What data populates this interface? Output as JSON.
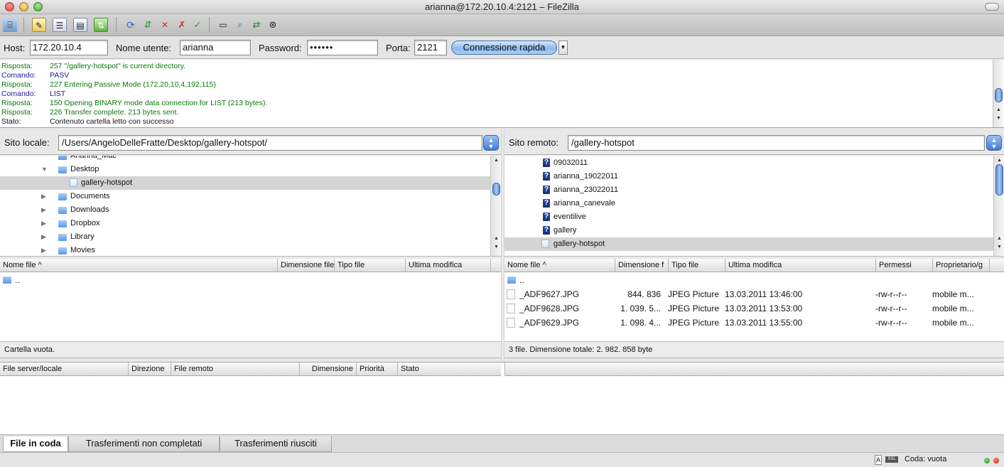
{
  "window": {
    "title": "arianna@172.20.10.4:2121 – FileZilla"
  },
  "toolbar": {
    "icons": [
      "site-manager-icon",
      "message-log-icon",
      "local-tree-icon",
      "remote-tree-icon",
      "transfer-queue-icon",
      "refresh-icon",
      "process-queue-icon",
      "cancel-icon",
      "disconnect-icon",
      "reconnect-icon",
      "filter-icon",
      "compare-icon",
      "sync-browse-icon",
      "search-icon"
    ]
  },
  "connection": {
    "host_label": "Host:",
    "host_value": "172.20.10.4",
    "user_label": "Nome utente:",
    "user_value": "arianna",
    "pass_label": "Password:",
    "pass_value": "••••••",
    "port_label": "Porta:",
    "port_value": "2121",
    "quick_label": "Connessione rapida",
    "accent": "#8cbaf0"
  },
  "log": [
    {
      "type": "Risposta:",
      "msg": "257 \"/gallery-hotspot\" is current directory.",
      "kind": "resp"
    },
    {
      "type": "Comando:",
      "msg": "PASV",
      "kind": "cmd"
    },
    {
      "type": "Risposta:",
      "msg": "227 Entering Passive Mode (172,20,10,4,192,115)",
      "kind": "resp"
    },
    {
      "type": "Comando:",
      "msg": "LIST",
      "kind": "cmd"
    },
    {
      "type": "Risposta:",
      "msg": "150 Opening BINARY mode data connection for LIST (213 bytes).",
      "kind": "resp"
    },
    {
      "type": "Risposta:",
      "msg": "226 Transfer complete. 213 bytes sent.",
      "kind": "resp"
    },
    {
      "type": "Stato:",
      "msg": "Contenuto cartella letto con successo",
      "kind": "stat"
    }
  ],
  "local": {
    "site_label": "Sito locale:",
    "path": "/Users/AngeloDelleFratte/Desktop/gallery-hotspot/",
    "tree": [
      {
        "name": "Arianna_Mac",
        "depth": 1,
        "tri": "",
        "selected": false,
        "open": false
      },
      {
        "name": "Desktop",
        "depth": 1,
        "tri": "▼",
        "selected": false,
        "open": false
      },
      {
        "name": "gallery-hotspot",
        "depth": 2,
        "tri": "",
        "selected": true,
        "open": true
      },
      {
        "name": "Documents",
        "depth": 1,
        "tri": "▶",
        "selected": false,
        "open": false
      },
      {
        "name": "Downloads",
        "depth": 1,
        "tri": "▶",
        "selected": false,
        "open": false
      },
      {
        "name": "Dropbox",
        "depth": 1,
        "tri": "▶",
        "selected": false,
        "open": false
      },
      {
        "name": "Library",
        "depth": 1,
        "tri": "▶",
        "selected": false,
        "open": false
      },
      {
        "name": "Movies",
        "depth": 1,
        "tri": "▶",
        "selected": false,
        "open": false
      }
    ],
    "columns": [
      "Nome file ^",
      "Dimensione file",
      "Tipo file",
      "Ultima modifica"
    ],
    "files": [
      {
        "name": ".."
      }
    ],
    "status": "Cartella vuota."
  },
  "remote": {
    "site_label": "Sito remoto:",
    "path": "/gallery-hotspot",
    "tree": [
      {
        "name": "09032011",
        "selected": false,
        "unknown": true
      },
      {
        "name": "arianna_19022011",
        "selected": false,
        "unknown": true
      },
      {
        "name": "arianna_23022011",
        "selected": false,
        "unknown": true
      },
      {
        "name": "arianna_canevale",
        "selected": false,
        "unknown": true
      },
      {
        "name": "eventilive",
        "selected": false,
        "unknown": true
      },
      {
        "name": "gallery",
        "selected": false,
        "unknown": true
      },
      {
        "name": "gallery-hotspot",
        "selected": true,
        "unknown": false
      }
    ],
    "columns": [
      "Nome file ^",
      "Dimensione f",
      "Tipo file",
      "Ultima modifica",
      "Permessi",
      "Proprietario/g"
    ],
    "files": [
      {
        "name": "..",
        "size": "",
        "type": "",
        "modified": "",
        "perms": "",
        "owner": "",
        "folder": true
      },
      {
        "name": "_ADF9627.JPG",
        "size": "844. 836",
        "type": "JPEG Picture",
        "modified": "13.03.2011 13:46:00",
        "perms": "-rw-r--r--",
        "owner": "mobile m...",
        "folder": false
      },
      {
        "name": "_ADF9628.JPG",
        "size": "1. 039. 5...",
        "type": "JPEG Picture",
        "modified": "13.03.2011 13:53:00",
        "perms": "-rw-r--r--",
        "owner": "mobile m...",
        "folder": false
      },
      {
        "name": "_ADF9629.JPG",
        "size": "1. 098. 4...",
        "type": "JPEG Picture",
        "modified": "13.03.2011 13:55:00",
        "perms": "-rw-r--r--",
        "owner": "mobile m...",
        "folder": false
      }
    ],
    "status": "3 file. Dimensione totale: 2. 982. 858 byte"
  },
  "queue": {
    "columns": [
      "File server/locale",
      "Direzione",
      "File remoto",
      "Dimensione",
      "Priorità",
      "Stato"
    ]
  },
  "tabs": [
    {
      "label": "File in coda",
      "active": true
    },
    {
      "label": "Trasferimenti non completati",
      "active": false
    },
    {
      "label": "Trasferimenti riusciti",
      "active": false
    }
  ],
  "statusbar": {
    "queue": "Coda: vuota"
  }
}
